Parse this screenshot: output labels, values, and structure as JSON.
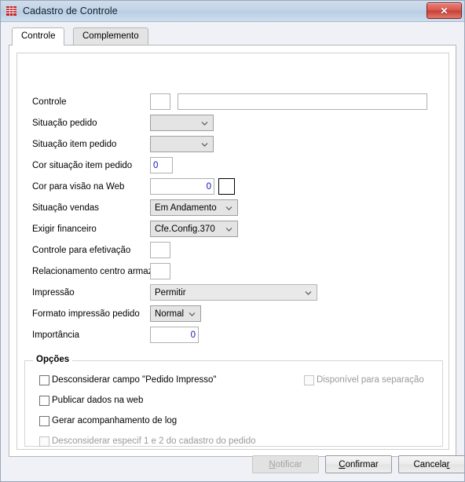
{
  "window": {
    "title": "Cadastro de Controle",
    "app_icon": "factory-icon",
    "close_label": "✕"
  },
  "tabs": [
    {
      "label": "Controle",
      "active": true
    },
    {
      "label": "Complemento",
      "active": false
    }
  ],
  "form": {
    "fields": [
      {
        "label": "Controle",
        "type": "text-pair",
        "value_small": "",
        "value_large": ""
      },
      {
        "label": "Situação pedido",
        "type": "combo",
        "value": ""
      },
      {
        "label": "Situação item pedido",
        "type": "combo",
        "value": ""
      },
      {
        "label": "Cor situação item pedido",
        "type": "num-left",
        "value": "0"
      },
      {
        "label": "Cor para visão na Web",
        "type": "num-right-swatch",
        "value": "0",
        "swatch_color": "#ffffff"
      },
      {
        "label": "Situação vendas",
        "type": "combo",
        "value": "Em Andamento"
      },
      {
        "label": "Exigir financeiro",
        "type": "combo",
        "value": "Cfe.Config.370"
      },
      {
        "label": "Controle para efetivação",
        "type": "small-box",
        "value": ""
      },
      {
        "label": "Relacionamento centro armaz.",
        "type": "small-box",
        "value": ""
      },
      {
        "label": "Impressão",
        "type": "combo",
        "value": "Permitir"
      },
      {
        "label": "Formato impressão pedido",
        "type": "combo",
        "value": "Normal"
      },
      {
        "label": "Importância",
        "type": "num-right",
        "value": "0"
      }
    ]
  },
  "options": {
    "title": "Opções",
    "left_checkboxes": [
      {
        "label": "Desconsiderar campo \"Pedido Impresso\"",
        "checked": false,
        "disabled": false
      },
      {
        "label": "Publicar dados na web",
        "checked": false,
        "disabled": false
      },
      {
        "label": "Gerar acompanhamento de log",
        "checked": false,
        "disabled": false
      },
      {
        "label": "Desconsiderar especif 1 e 2 do cadastro do pedido",
        "checked": false,
        "disabled": true
      }
    ],
    "right_checkboxes": [
      {
        "label": "Disponível para separação",
        "checked": false,
        "disabled": true
      }
    ]
  },
  "footer": {
    "buttons": [
      {
        "label": "Notificar",
        "accel": "N",
        "disabled": true
      },
      {
        "label": "Confirmar",
        "accel": "C",
        "disabled": false
      },
      {
        "label": "Cancelar",
        "accel": "r",
        "disabled": false
      }
    ]
  },
  "colors": {
    "value_text": "#1414b4",
    "titlebar_start": "#cfdcea",
    "titlebar_end": "#cddded",
    "close_red": "#d8564b"
  }
}
